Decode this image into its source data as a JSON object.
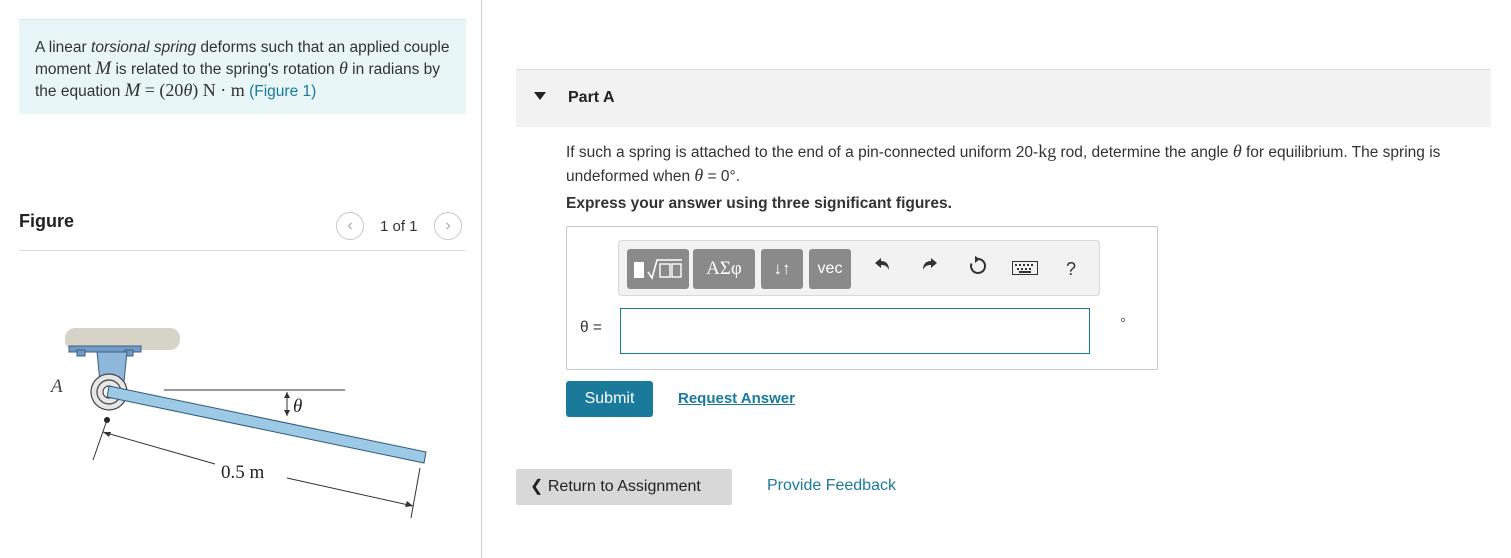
{
  "problem": {
    "pre1": "A linear ",
    "em": "torsional spring",
    "post1": " deforms such that an applied couple moment ",
    "M": "M",
    "post2": " is related to the spring's rotation ",
    "theta": "θ",
    "post3": " in radians by the equation ",
    "eq_M": "M",
    "eq_rest": "= (20",
    "eq_theta": "θ",
    "eq_units": ") N · m",
    "figure_link": "(Figure 1)"
  },
  "figure": {
    "title": "Figure",
    "prev_icon": "‹",
    "next_icon": "›",
    "counter": "1 of 1",
    "label_A": "A",
    "label_theta": "θ",
    "label_length": "0.5 m"
  },
  "part": {
    "title": "Part A",
    "question_pre": "If such a spring is attached to the end of a pin-connected uniform 20-",
    "question_kg": "kg",
    "question_mid": " rod, determine the angle ",
    "question_theta": "θ",
    "question_mid2": " for equilibrium. The spring is undeformed when ",
    "question_theta2": "θ",
    "question_end": " = 0°.",
    "instruction": "Express your answer using three significant figures."
  },
  "toolbar": {
    "templates_icon": "template-radical-icon",
    "greek_label": "ΑΣφ",
    "arrows_label": "↓↑",
    "vec_label": "vec",
    "undo_icon": "undo-icon",
    "redo_icon": "redo-icon",
    "reset_icon": "reset-icon",
    "keyboard_icon": "keyboard-icon",
    "help_label": "?"
  },
  "answer": {
    "variable_label": "θ =",
    "value": "",
    "unit": "°"
  },
  "actions": {
    "submit": "Submit",
    "request": "Request Answer",
    "return": "Return to Assignment",
    "return_icon": "❮",
    "feedback": "Provide Feedback"
  }
}
